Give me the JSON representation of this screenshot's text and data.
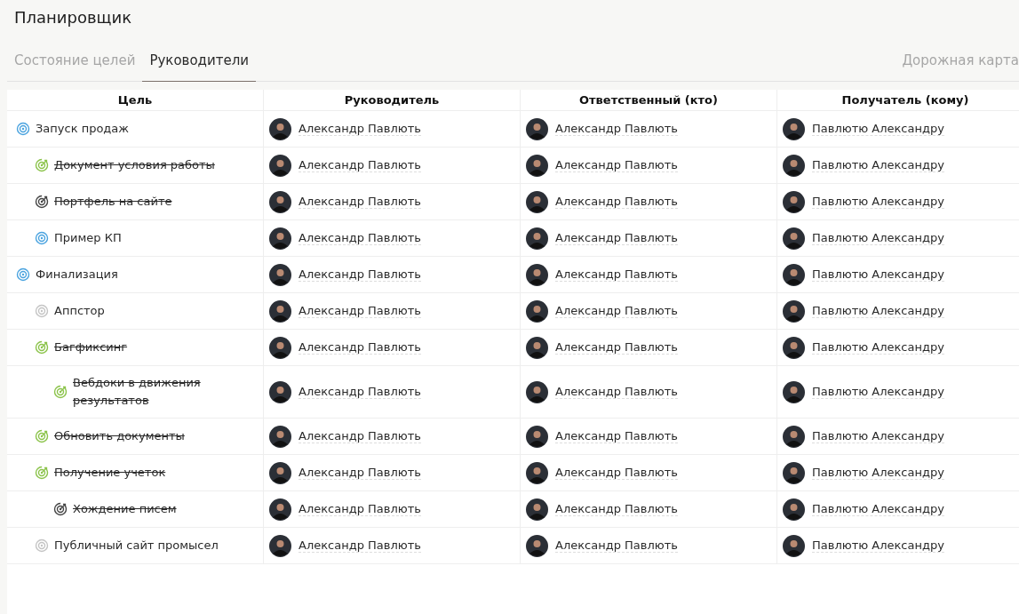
{
  "title": "Планировщик",
  "tabs": [
    {
      "label": "Состояние целей",
      "selected": false
    },
    {
      "label": "Руководители",
      "selected": true
    }
  ],
  "roadmap_link": "Дорожная карта",
  "table": {
    "columns": [
      "Цель",
      "Руководитель",
      "Ответственный (кто)",
      "Получатель (кому)"
    ],
    "goals": [
      {
        "name": "Запуск продаж",
        "kind": "active",
        "manager": "Александр Павлють",
        "responsible": "Александр Павлють",
        "recipient": "Павлютю Александру",
        "children": [
          {
            "name": "Документ условия работы",
            "kind": "done",
            "manager": "Александр Павлють",
            "responsible": "Александр Павлють",
            "recipient": "Павлютю Александру"
          },
          {
            "name": "Портфель на сайте",
            "kind": "closed",
            "manager": "Александр Павлють",
            "responsible": "Александр Павлють",
            "recipient": "Павлютю Александру"
          },
          {
            "name": "Пример КП",
            "kind": "active",
            "manager": "Александр Павлють",
            "responsible": "Александр Павлють",
            "recipient": "Павлютю Александру"
          }
        ]
      },
      {
        "name": "Финализация",
        "kind": "active",
        "manager": "Александр Павлють",
        "responsible": "Александр Павлють",
        "recipient": "Павлютю Александру",
        "children": [
          {
            "name": "Аппстор",
            "kind": "inactive",
            "manager": "Александр Павлють",
            "responsible": "Александр Павлють",
            "recipient": "Павлютю Александру"
          },
          {
            "name": "Багфиксинг",
            "kind": "done",
            "manager": "Александр Павлють",
            "responsible": "Александр Павлють",
            "recipient": "Павлютю Александру",
            "children": [
              {
                "name": "Вебдоки в движения результатов",
                "kind": "done",
                "manager": "Александр Павлють",
                "responsible": "Александр Павлють",
                "recipient": "Павлютю Александру"
              }
            ]
          },
          {
            "name": "Обновить документы",
            "kind": "done",
            "manager": "Александр Павлють",
            "responsible": "Александр Павлють",
            "recipient": "Павлютю Александру"
          },
          {
            "name": "Получение учеток",
            "kind": "done",
            "manager": "Александр Павлють",
            "responsible": "Александр Павлють",
            "recipient": "Павлютю Александру",
            "children": [
              {
                "name": "Хождение писем",
                "kind": "closed",
                "manager": "Александр Павлють",
                "responsible": "Александр Павлють",
                "recipient": "Павлютю Александру"
              }
            ]
          },
          {
            "name": "Публичный сайт промысел",
            "kind": "inactive",
            "manager": "Александр Павлють",
            "responsible": "Александр Павлють",
            "recipient": "Павлютю Александру"
          }
        ]
      }
    ]
  }
}
